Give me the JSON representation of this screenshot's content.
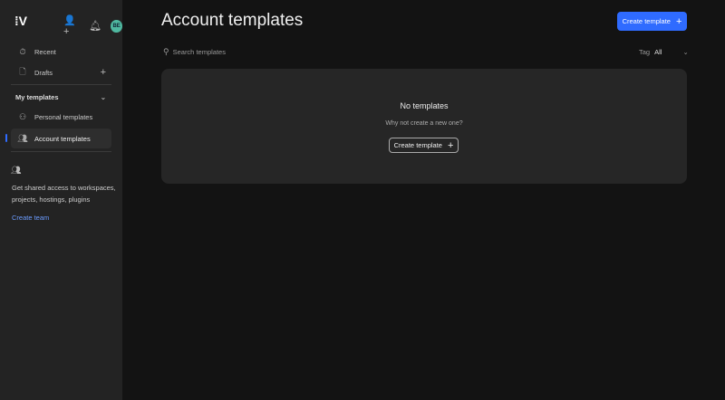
{
  "sidebar": {
    "logo": "⁞V",
    "avatar": "BE",
    "items": [
      {
        "label": "Recent"
      },
      {
        "label": "Drafts"
      },
      {
        "label": "Personal templates"
      },
      {
        "label": "Account templates"
      }
    ],
    "section": "My templates",
    "team_text": "Get shared access to workspaces, projects, hostings, plugins",
    "team_link": "Create team"
  },
  "main": {
    "title": "Account templates",
    "create_label": "Create template",
    "search_placeholder": "Search templates",
    "tag_label": "Tag",
    "tag_value": "All",
    "empty_title": "No templates",
    "empty_sub": "Why not create a new one?",
    "empty_button": "Create template"
  },
  "colors": {
    "accent": "#2f6bff",
    "avatar": "#4fb8a0"
  }
}
